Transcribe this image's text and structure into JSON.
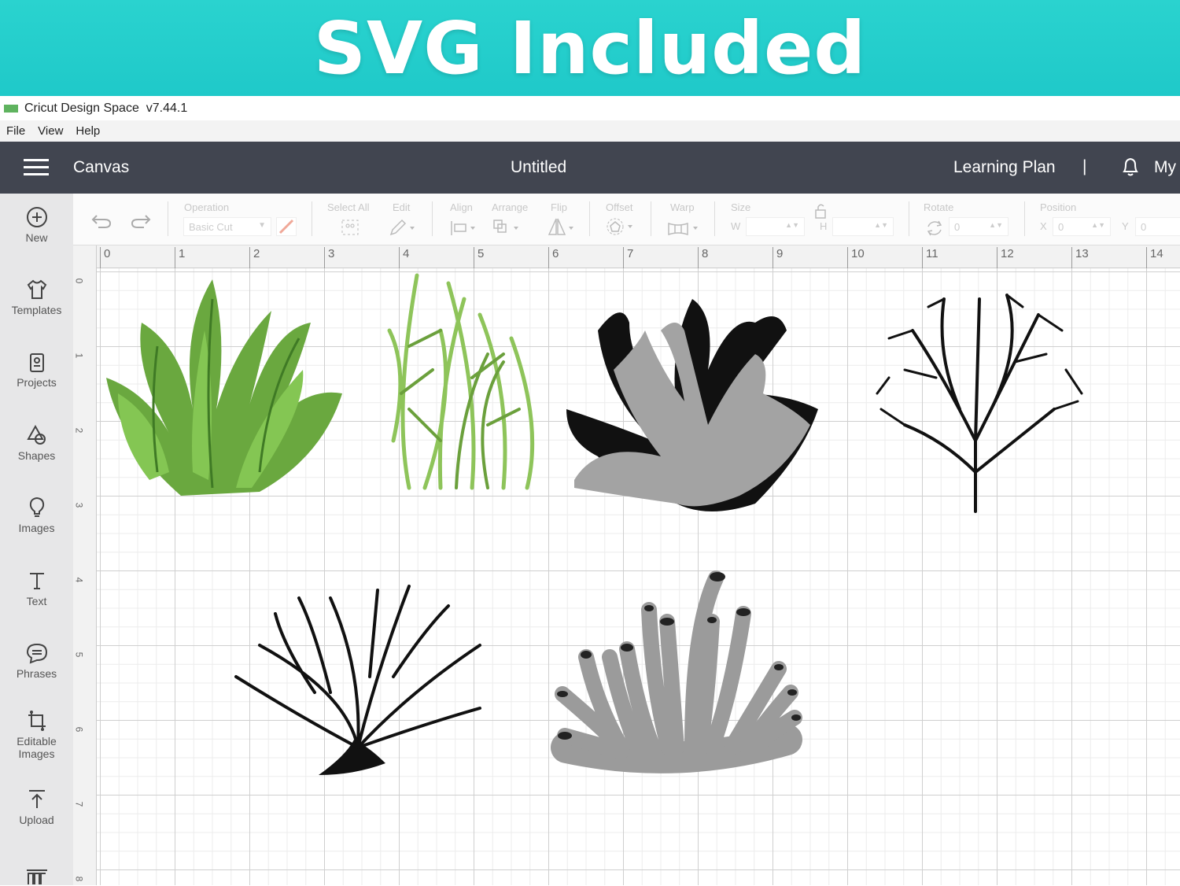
{
  "banner": {
    "title": "SVG Included"
  },
  "window": {
    "app": "Cricut Design Space",
    "version": "v7.44.1",
    "logo": "cricut"
  },
  "menu": [
    "File",
    "View",
    "Help"
  ],
  "header": {
    "section": "Canvas",
    "doc_title": "Untitled",
    "learning": "Learning Plan",
    "sep": "|",
    "my": "My"
  },
  "sidebar": [
    {
      "label": "New",
      "icon": "plus-circle"
    },
    {
      "label": "Templates",
      "icon": "shirt"
    },
    {
      "label": "Projects",
      "icon": "clipboard"
    },
    {
      "label": "Shapes",
      "icon": "shapes"
    },
    {
      "label": "Images",
      "icon": "lightbulb"
    },
    {
      "label": "Text",
      "icon": "text-T"
    },
    {
      "label": "Phrases",
      "icon": "speech-bubble"
    },
    {
      "label": "Editable",
      "label2": "Images",
      "icon": "edit-image"
    },
    {
      "label": "Upload",
      "icon": "upload"
    }
  ],
  "toolbar": {
    "operation": "Operation",
    "operation_value": "Basic Cut",
    "select_all": "Select All",
    "edit": "Edit",
    "align": "Align",
    "arrange": "Arrange",
    "flip": "Flip",
    "offset": "Offset",
    "warp": "Warp",
    "size": "Size",
    "w": "W",
    "h": "H",
    "rotate": "Rotate",
    "rotate_value": "0",
    "position": "Position",
    "x": "X",
    "x_value": "0",
    "y": "Y",
    "y_value": "0"
  },
  "ruler": {
    "h": [
      "0",
      "1",
      "2",
      "3",
      "4",
      "5",
      "6",
      "7",
      "8",
      "9",
      "10",
      "11",
      "12",
      "13",
      "14"
    ],
    "v": [
      "0",
      "1",
      "2",
      "3",
      "4",
      "5",
      "6",
      "7",
      "8"
    ]
  },
  "colors": {
    "banner": "#22cfcc",
    "header": "#414550",
    "green_dark": "#5a9a3c",
    "green_light": "#7cc04a",
    "gray": "#a3a3a3"
  }
}
